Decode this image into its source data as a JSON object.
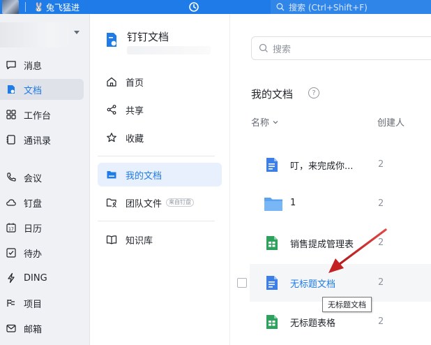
{
  "topbar": {
    "status_emoji": "🐰",
    "status_text": "兔飞猛进",
    "search_placeholder": "搜索 (Ctrl+Shift+F)"
  },
  "leftnav": {
    "items": [
      {
        "label": "消息",
        "icon": "message-icon"
      },
      {
        "label": "文档",
        "icon": "docs-icon",
        "active": true
      },
      {
        "label": "工作台",
        "icon": "workbench-icon"
      },
      {
        "label": "通讯录",
        "icon": "contacts-icon"
      },
      {
        "label": "会议",
        "icon": "meeting-icon"
      },
      {
        "label": "钉盘",
        "icon": "cloud-drive-icon"
      },
      {
        "label": "日历",
        "icon": "calendar-icon"
      },
      {
        "label": "待办",
        "icon": "todo-icon"
      },
      {
        "label": "DING",
        "icon": "ding-icon"
      },
      {
        "label": "项目",
        "icon": "project-icon"
      },
      {
        "label": "邮箱",
        "icon": "mail-icon"
      }
    ]
  },
  "docpanel": {
    "title": "钉钉文档",
    "items": [
      {
        "label": "首页",
        "icon": "home-icon"
      },
      {
        "label": "共享",
        "icon": "share-icon"
      },
      {
        "label": "收藏",
        "icon": "star-icon"
      },
      {
        "label": "我的文档",
        "icon": "folder-icon",
        "active": true
      },
      {
        "label": "团队文件",
        "icon": "team-folder-icon",
        "tag": "来自钉盘"
      },
      {
        "label": "知识库",
        "icon": "book-icon"
      }
    ]
  },
  "main": {
    "search_placeholder": "搜索",
    "page_title": "我的文档",
    "columns": {
      "name": "名称",
      "creator": "创建人"
    },
    "rows": [
      {
        "name": "叮，来完成你...",
        "creator": "2",
        "type": "doc"
      },
      {
        "name": "1",
        "creator": "2",
        "type": "folder"
      },
      {
        "name": "销售提成管理表",
        "creator": "2",
        "type": "sheet"
      },
      {
        "name": "无标题文档",
        "creator": "2",
        "type": "doc",
        "hovered": true
      },
      {
        "name": "无标题表格",
        "creator": "2",
        "type": "sheet"
      }
    ],
    "tooltip": "无标题文档"
  },
  "colors": {
    "accent": "#1f7be8",
    "doc_icon": "#3d7fe6",
    "sheet_icon": "#2ea15c",
    "folder_icon": "#5aa3f0",
    "arrow": "#d42b2b"
  }
}
